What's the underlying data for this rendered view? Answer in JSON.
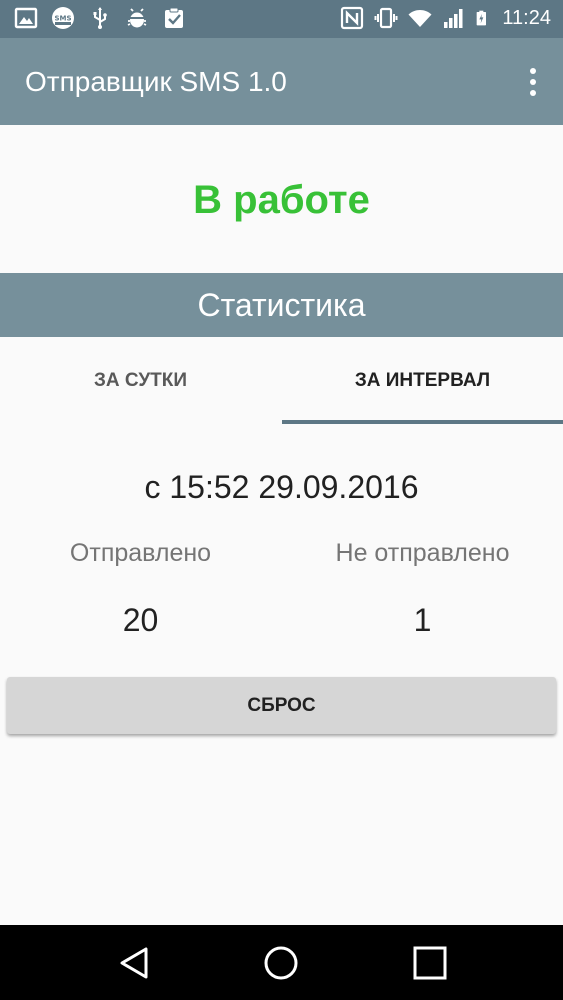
{
  "status_bar": {
    "time": "11:24",
    "sms_badge": "SMS"
  },
  "app_bar": {
    "title": "Отправщик SMS 1.0"
  },
  "service_status": "В работе",
  "statistics": {
    "header": "Статистика",
    "tabs": [
      {
        "label": "ЗА СУТКИ",
        "selected": false
      },
      {
        "label": "ЗА ИНТЕРВАЛ",
        "selected": true
      }
    ],
    "interval": "с 15:52 29.09.2016",
    "sent_label": "Отправлено",
    "sent_value": "20",
    "not_sent_label": "Не отправлено",
    "not_sent_value": "1",
    "reset_button": "СБРОС"
  },
  "colors": {
    "status_bar": "#5d7785",
    "app_bar": "#76909b",
    "status_ok": "#38c137",
    "tab_indicator": "#5d7785",
    "button": "#d6d6d6"
  },
  "icons": {
    "status_left": [
      "gallery-icon",
      "sms-icon",
      "usb-icon",
      "android-debug-icon",
      "clipboard-check-icon"
    ],
    "status_right": [
      "nfc-icon",
      "vibrate-icon",
      "wifi-icon",
      "signal-icon",
      "battery-icon"
    ],
    "navigation": [
      "back-icon",
      "home-icon",
      "recent-apps-icon"
    ]
  }
}
